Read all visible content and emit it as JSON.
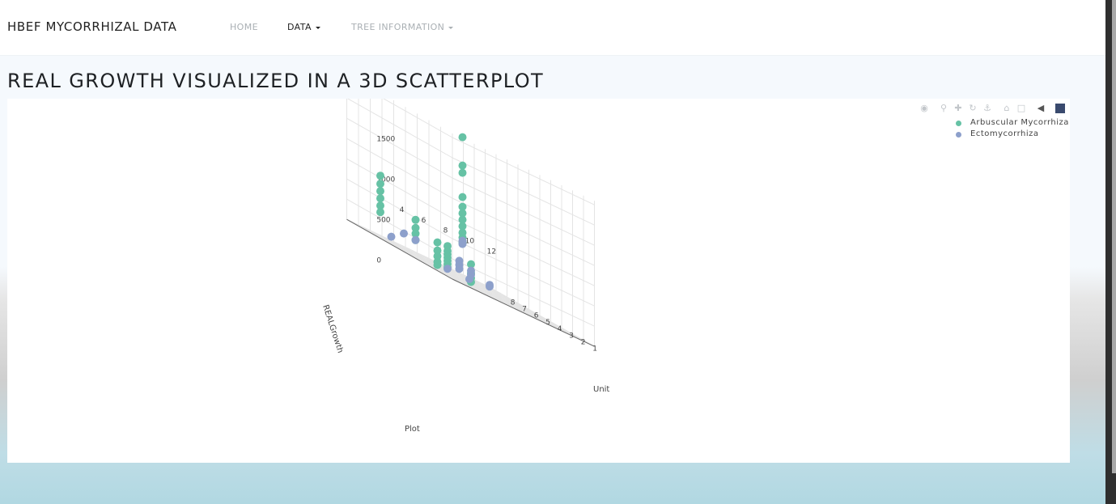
{
  "navbar": {
    "brand": "HBEF MYCORRHIZAL DATA",
    "items": [
      {
        "label": "HOME",
        "dropdown": false,
        "active": false
      },
      {
        "label": "DATA",
        "dropdown": true,
        "active": true
      },
      {
        "label": "TREE INFORMATION",
        "dropdown": true,
        "active": false
      }
    ]
  },
  "page": {
    "title": "REAL GROWTH VISUALIZED IN A 3D SCATTERPLOT"
  },
  "modebar": {
    "icons": [
      "camera-icon",
      "zoom-icon",
      "pan-icon",
      "orbit-rotation-icon",
      "turntable-rotation-icon",
      "reset-camera-icon",
      "last-saved-camera-icon",
      "hover-toggle-icon",
      "plotly-logo-icon"
    ]
  },
  "legend": {
    "items": [
      {
        "label": "Arbuscular Mycorrhiza",
        "color": "#66c2a5"
      },
      {
        "label": "Ectomycorrhiza",
        "color": "#8da0cb"
      }
    ]
  },
  "chart_data": {
    "type": "scatter",
    "dimension": "3d",
    "axes": {
      "x": {
        "title": "Plot",
        "ticks": [
          "1",
          "2",
          "3",
          "4",
          "5",
          "6",
          "7",
          "8"
        ]
      },
      "y": {
        "title": "Unit",
        "ticks": [
          "2",
          "4",
          "6",
          "8",
          "10",
          "12"
        ]
      },
      "z": {
        "title": "REALGrowth",
        "ticks": [
          "0",
          "500",
          "1000",
          "1500"
        ],
        "range": [
          0,
          1800
        ]
      }
    },
    "grid": true,
    "legend_position": "top-right",
    "series": [
      {
        "name": "Arbuscular Mycorrhiza",
        "color": "#66c2a5",
        "points": [
          {
            "plot": 1,
            "unit": 2,
            "growth": 1800
          },
          {
            "plot": 1,
            "unit": 2,
            "growth": 1450
          },
          {
            "plot": 1,
            "unit": 2,
            "growth": 1360
          },
          {
            "plot": 1,
            "unit": 2,
            "growth": 1060
          },
          {
            "plot": 1,
            "unit": 2,
            "growth": 940
          },
          {
            "plot": 1,
            "unit": 2,
            "growth": 860
          },
          {
            "plot": 1,
            "unit": 2,
            "growth": 780
          },
          {
            "plot": 1,
            "unit": 2,
            "growth": 700
          },
          {
            "plot": 1,
            "unit": 2,
            "growth": 620
          },
          {
            "plot": 1,
            "unit": 2,
            "growth": 560
          },
          {
            "plot": 1,
            "unit": 2,
            "growth": 500
          },
          {
            "plot": 4,
            "unit": 6,
            "growth": 240
          },
          {
            "plot": 4,
            "unit": 6,
            "growth": 130
          },
          {
            "plot": 4,
            "unit": 6,
            "growth": 70
          },
          {
            "plot": 4,
            "unit": 6,
            "growth": 20
          },
          {
            "plot": 5,
            "unit": 4,
            "growth": 300
          },
          {
            "plot": 5,
            "unit": 4,
            "growth": 200
          },
          {
            "plot": 5,
            "unit": 4,
            "growth": 130
          },
          {
            "plot": 5,
            "unit": 4,
            "growth": 60
          },
          {
            "plot": 5,
            "unit": 4,
            "growth": 20
          },
          {
            "plot": 5,
            "unit": 2,
            "growth": 450
          },
          {
            "plot": 5,
            "unit": 2,
            "growth": 350
          },
          {
            "plot": 5,
            "unit": 2,
            "growth": 280
          },
          {
            "plot": 5,
            "unit": 2,
            "growth": 200
          },
          {
            "plot": 6,
            "unit": 6,
            "growth": 300
          },
          {
            "plot": 6,
            "unit": 6,
            "growth": 240
          },
          {
            "plot": 6,
            "unit": 6,
            "growth": 200
          },
          {
            "plot": 6,
            "unit": 6,
            "growth": 160
          },
          {
            "plot": 6,
            "unit": 6,
            "growth": 120
          },
          {
            "plot": 6,
            "unit": 6,
            "growth": 80
          },
          {
            "plot": 6,
            "unit": 6,
            "growth": 40
          },
          {
            "plot": 8,
            "unit": 2,
            "growth": 750
          },
          {
            "plot": 8,
            "unit": 2,
            "growth": 650
          },
          {
            "plot": 8,
            "unit": 2,
            "growth": 560
          },
          {
            "plot": 8,
            "unit": 2,
            "growth": 470
          },
          {
            "plot": 8,
            "unit": 2,
            "growth": 380
          },
          {
            "plot": 8,
            "unit": 2,
            "growth": 300
          }
        ]
      },
      {
        "name": "Ectomycorrhiza",
        "color": "#8da0cb",
        "points": [
          {
            "plot": 1,
            "unit": 2,
            "growth": 520
          },
          {
            "plot": 1,
            "unit": 2,
            "growth": 480
          },
          {
            "plot": 4,
            "unit": 6,
            "growth": 160
          },
          {
            "plot": 4,
            "unit": 6,
            "growth": 110
          },
          {
            "plot": 5,
            "unit": 6,
            "growth": 200
          },
          {
            "plot": 5,
            "unit": 6,
            "growth": 150
          },
          {
            "plot": 5,
            "unit": 6,
            "growth": 100
          },
          {
            "plot": 5,
            "unit": 2,
            "growth": 200
          },
          {
            "plot": 6,
            "unit": 2,
            "growth": 200
          },
          {
            "plot": 6,
            "unit": 6,
            "growth": 20
          },
          {
            "plot": 6,
            "unit": 8,
            "growth": 20
          },
          {
            "plot": 8,
            "unit": 3,
            "growth": 60
          },
          {
            "plot": 8,
            "unit": 12,
            "growth": 40
          },
          {
            "plot": 8,
            "unit": 12,
            "growth": 20
          }
        ]
      }
    ]
  }
}
